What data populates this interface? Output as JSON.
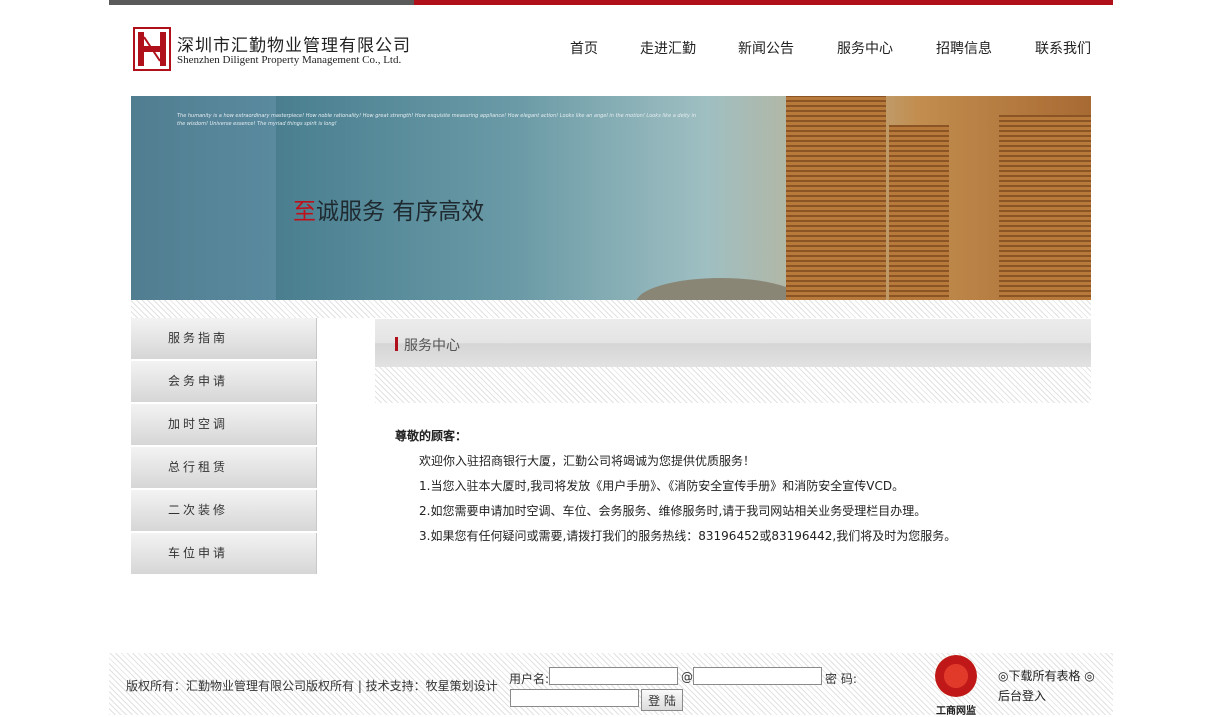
{
  "brand": {
    "name_cn": "深圳市汇勤物业管理有限公司",
    "name_en": "Shenzhen Diligent Property Management Co., Ltd.",
    "accent_color": "#b0101a"
  },
  "nav": [
    "首页",
    "走进汇勤",
    "新闻公告",
    "服务中心",
    "招聘信息",
    "联系我们"
  ],
  "banner": {
    "tagline": "The humanity is a how extraordinary masterpiece! How noble rationality! How great strength! How exquisite measuring appliance! How elegant action! Looks like an angel in the motion! Looks like a deity in the wisdom! Universe essence! The myriad things spirit is long!",
    "slogan_highlight": "至",
    "slogan_rest": "诚服务  有序高效"
  },
  "sidebar": {
    "items": [
      "服务指南",
      "会务申请",
      "加时空调",
      "总行租赁",
      "二次装修",
      "车位申请"
    ]
  },
  "content": {
    "section_title": "服务中心",
    "greeting": "尊敬的顾客：",
    "paragraphs": [
      "欢迎你入驻招商银行大厦，汇勤公司将竭诚为您提供优质服务！",
      "1.当您入驻本大厦时,我司将发放《用户手册》、《消防安全宣传手册》和消防安全宣传VCD。",
      "2.如您需要申请加时空调、车位、会务服务、维修服务时,请于我司网站相关业务受理栏目办理。",
      "3.如果您有任何疑问或需要,请拨打我们的服务热线：83196452或83196442,我们将及时为您服务。"
    ]
  },
  "footer": {
    "copyright": "版权所有：汇勤物业管理有限公司版权所有 | 技术支持：牧星策划设计",
    "username_label": "用户名:",
    "at_symbol": "@",
    "password_label": "密  码:",
    "username_value": "",
    "domain_value": "",
    "password_value": "",
    "login_button": "登 陆",
    "badge_text": "工商网监",
    "download_link": "◎下载所有表格 ◎",
    "admin_link": "后台登入"
  }
}
